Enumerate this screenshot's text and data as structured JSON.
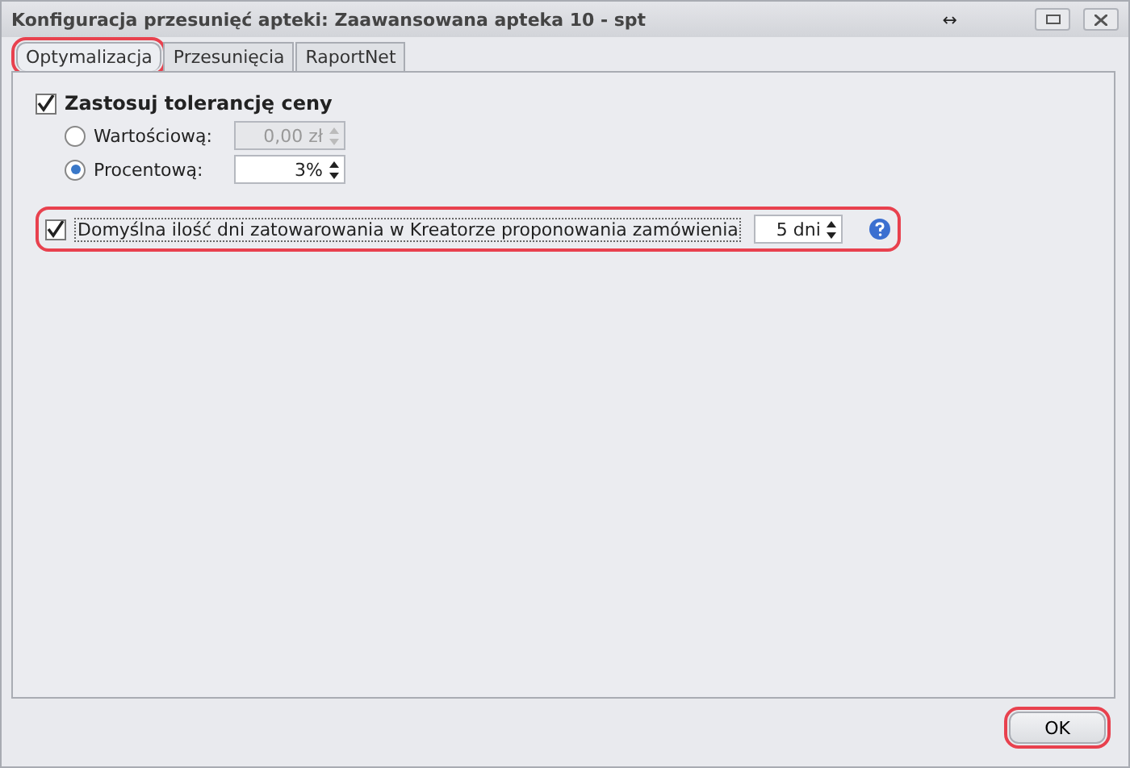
{
  "window": {
    "title": "Konfiguracja przesunięć apteki: Zaawansowana apteka 10 - spt",
    "resize_cursor": "↔"
  },
  "tabs": [
    {
      "label": "Optymalizacja",
      "selected": true,
      "highlighted": true
    },
    {
      "label": "Przesunięcia",
      "selected": false,
      "highlighted": false
    },
    {
      "label": "RaportNet",
      "selected": false,
      "highlighted": false
    }
  ],
  "price_tolerance": {
    "label": "Zastosuj tolerancję ceny",
    "checked": true,
    "options": [
      {
        "label": "Wartościową:",
        "selected": false,
        "value": "0,00 zł",
        "disabled": true
      },
      {
        "label": "Procentową:",
        "selected": true,
        "value": "3%",
        "disabled": false
      }
    ]
  },
  "stock_days": {
    "label": "Domyślna ilość dni zatowarowania w Kreatorze proponowania zamówienia",
    "checked": true,
    "value": "5 dni",
    "highlighted": true
  },
  "buttons": [
    {
      "label": "OK",
      "highlighted": true
    }
  ]
}
